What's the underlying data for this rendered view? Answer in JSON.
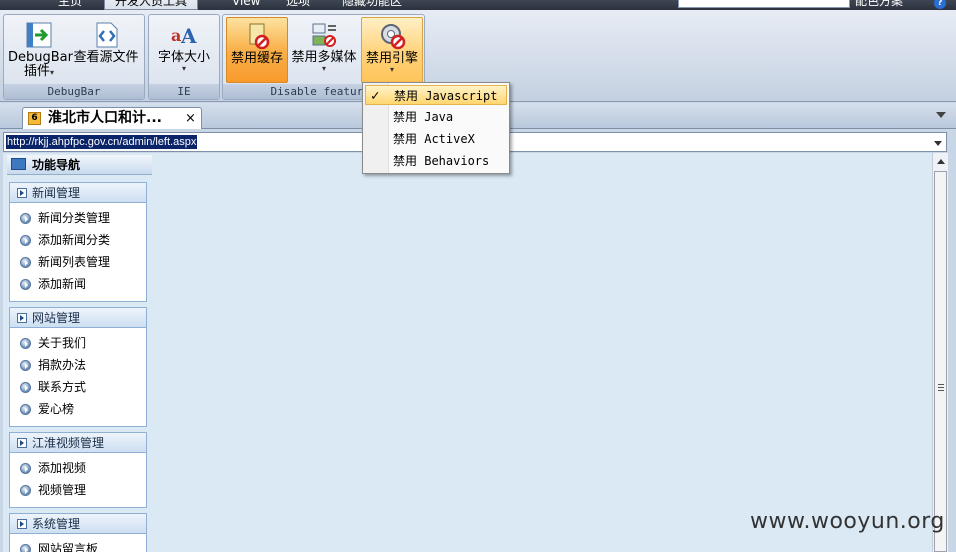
{
  "ribbon_tabs": [
    "主页",
    "开发人员工具",
    "View",
    "选项",
    "隐藏功能区"
  ],
  "ribbon_right_text": "配色方案",
  "ribbon_groups": {
    "debugbar": {
      "label": "DebugBar",
      "buttons": [
        {
          "label_line1": "DebugBar",
          "label_line2": "插件"
        },
        {
          "label_line1": "查看源文件"
        }
      ]
    },
    "ie": {
      "label": "IE",
      "buttons": [
        {
          "label_line1": "字体大小"
        }
      ]
    },
    "disable": {
      "label": "Disable features",
      "buttons": [
        {
          "label_line1": "禁用缓存"
        },
        {
          "label_line1": "禁用多媒体"
        },
        {
          "label_line1": "禁用引擎"
        }
      ]
    }
  },
  "dropdown_menu": {
    "items": [
      {
        "label": "禁用 Javascript",
        "checked": true
      },
      {
        "label": "禁用 Java",
        "checked": false
      },
      {
        "label": "禁用 ActiveX",
        "checked": false
      },
      {
        "label": "禁用 Behaviors",
        "checked": false
      }
    ],
    "check_glyph": "✓"
  },
  "doc_tab": {
    "number": "6",
    "title": "淮北市人口和计...",
    "close": "×"
  },
  "address": {
    "url": "http://rkjj.ahpfpc.gov.cn/admin/left.aspx"
  },
  "nav": {
    "header": "功能导航",
    "sections": [
      {
        "title": "新闻管理",
        "items": [
          "新闻分类管理",
          "添加新闻分类",
          "新闻列表管理",
          "添加新闻"
        ]
      },
      {
        "title": "网站管理",
        "items": [
          "关于我们",
          "捐款办法",
          "联系方式",
          "爱心榜"
        ]
      },
      {
        "title": "江淮视频管理",
        "items": [
          "添加视频",
          "视频管理"
        ]
      },
      {
        "title": "系统管理",
        "items": [
          "网站留言板"
        ]
      }
    ]
  },
  "watermark": "www.wooyun.org",
  "colors": {
    "content_bg": "#dbe9f5",
    "highlight_orange": "#f9b04a",
    "url_selection": "#0a246a"
  }
}
